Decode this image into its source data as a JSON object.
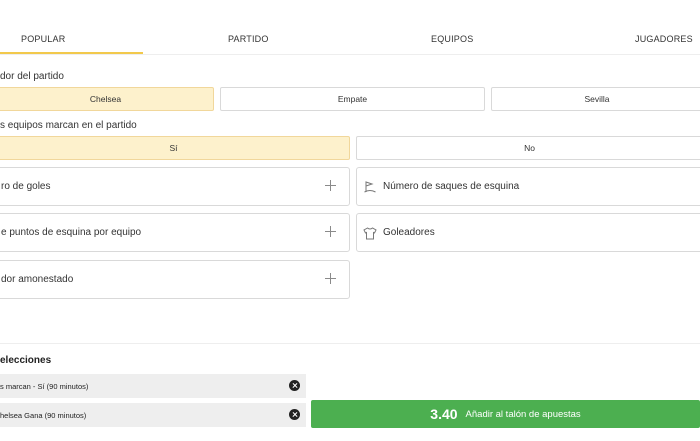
{
  "tabs": [
    {
      "label": "POPULAR",
      "active": true
    },
    {
      "label": "PARTIDO",
      "active": false
    },
    {
      "label": "EQUIPOS",
      "active": false
    },
    {
      "label": "JUGADORES",
      "active": false
    }
  ],
  "markets": {
    "winner": {
      "title": "dor del partido",
      "options": [
        {
          "label": "Chelsea",
          "selected": true
        },
        {
          "label": "Empate",
          "selected": false
        },
        {
          "label": "Sevilla",
          "selected": false
        }
      ]
    },
    "btts": {
      "title": "s equipos marcan en el partido",
      "options": [
        {
          "label": "Sí",
          "selected": true
        },
        {
          "label": "No",
          "selected": false
        }
      ]
    },
    "collapsed": [
      {
        "label": "ro de goles",
        "icon": "plus-icon"
      },
      {
        "label": "Número de saques de esquina",
        "icon": "corner-flag-icon"
      },
      {
        "label": "e puntos de esquina por equipo",
        "icon": "plus-icon"
      },
      {
        "label": "Goleadores",
        "icon": "shirt-icon"
      },
      {
        "label": "dor amonestado",
        "icon": "plus-icon"
      }
    ]
  },
  "betslip": {
    "title": "elecciones",
    "selections": [
      {
        "label": "s marcan - Sí (90 minutos)"
      },
      {
        "label": "helsea Gana (90 minutos)"
      }
    ],
    "odds": "3.40",
    "add_label": "Añadir al talón de apuestas"
  },
  "colors": {
    "accent": "#f2c94c",
    "selected_bg": "#fdf1cc",
    "add_button": "#4caf50"
  }
}
